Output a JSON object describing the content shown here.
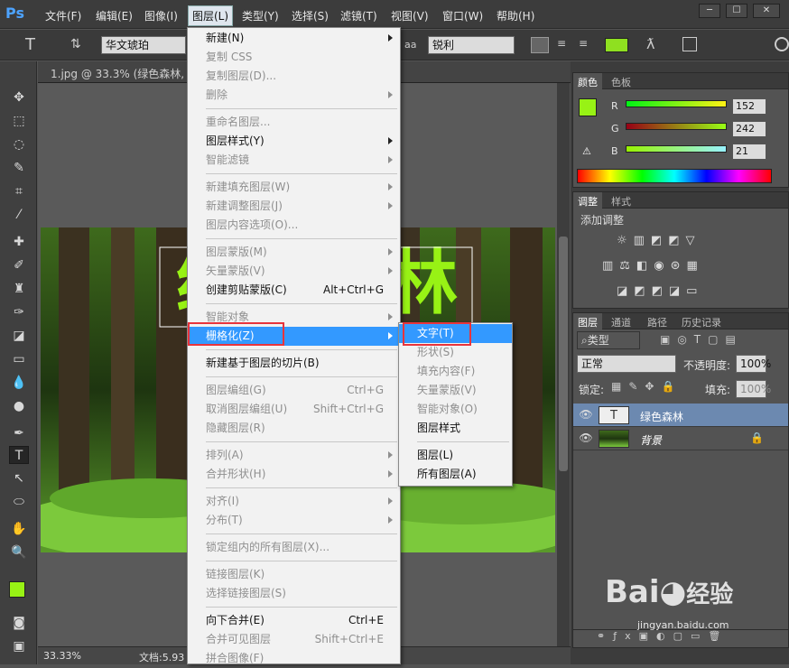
{
  "app": {
    "logo": "Ps"
  },
  "menubar": {
    "items": [
      "文件(F)",
      "编辑(E)",
      "图像(I)",
      "图层(L)",
      "类型(Y)",
      "选择(S)",
      "滤镜(T)",
      "视图(V)",
      "窗口(W)",
      "帮助(H)"
    ]
  },
  "window": {
    "min": "─",
    "max": "☐",
    "close": "✕"
  },
  "options": {
    "font_family": "华文琥珀",
    "aa_label": "aa",
    "aa_mode": "锐利",
    "text_color": "#8fe020"
  },
  "document": {
    "tab_title": "1.jpg @ 33.3% (绿色森林, R",
    "canvas_text": "绿色森林"
  },
  "status": {
    "zoom": "33.33%",
    "doc": "文档:5.93"
  },
  "color_panel": {
    "tabs": [
      "颜色",
      "色板"
    ],
    "r": "152",
    "g": "242",
    "b": "21",
    "r_label": "R",
    "g_label": "G",
    "b_label": "B",
    "fg": "#98f215"
  },
  "adjust_panel": {
    "tabs": [
      "调整",
      "样式"
    ],
    "title": "添加调整"
  },
  "layers_panel": {
    "tabs": [
      "图层",
      "通道",
      "路径",
      "历史记录"
    ],
    "filter": "类型",
    "blend": "正常",
    "opacity_label": "不透明度:",
    "opacity": "100%",
    "lock_label": "锁定:",
    "fill_label": "填充:",
    "fill": "100%",
    "layers": [
      {
        "name": "绿色森林",
        "type": "T"
      },
      {
        "name": "背景",
        "locked": true
      }
    ]
  },
  "layer_menu": {
    "items": [
      {
        "label": "新建(N)",
        "sub": true
      },
      {
        "label": "复制 CSS",
        "dis": true
      },
      {
        "label": "复制图层(D)...",
        "dis": true
      },
      {
        "label": "删除",
        "dis": true,
        "sub": true
      },
      {
        "sep": true
      },
      {
        "label": "重命名图层...",
        "dis": true
      },
      {
        "label": "图层样式(Y)",
        "sub": true
      },
      {
        "label": "智能滤镜",
        "dis": true,
        "sub": true
      },
      {
        "sep": true
      },
      {
        "label": "新建填充图层(W)",
        "dis": true,
        "sub": true
      },
      {
        "label": "新建调整图层(J)",
        "dis": true,
        "sub": true
      },
      {
        "label": "图层内容选项(O)...",
        "dis": true
      },
      {
        "sep": true
      },
      {
        "label": "图层蒙版(M)",
        "dis": true,
        "sub": true
      },
      {
        "label": "矢量蒙版(V)",
        "dis": true,
        "sub": true
      },
      {
        "label": "创建剪贴蒙版(C)",
        "shortcut": "Alt+Ctrl+G"
      },
      {
        "sep": true
      },
      {
        "label": "智能对象",
        "dis": true,
        "sub": true
      },
      {
        "label": "栅格化(Z)",
        "sub": true,
        "hl": true
      },
      {
        "sep": true
      },
      {
        "label": "新建基于图层的切片(B)"
      },
      {
        "sep": true
      },
      {
        "label": "图层编组(G)",
        "dis": true,
        "shortcut": "Ctrl+G"
      },
      {
        "label": "取消图层编组(U)",
        "dis": true,
        "shortcut": "Shift+Ctrl+G"
      },
      {
        "label": "隐藏图层(R)",
        "dis": true
      },
      {
        "sep": true
      },
      {
        "label": "排列(A)",
        "dis": true,
        "sub": true
      },
      {
        "label": "合并形状(H)",
        "dis": true,
        "sub": true
      },
      {
        "sep": true
      },
      {
        "label": "对齐(I)",
        "dis": true,
        "sub": true
      },
      {
        "label": "分布(T)",
        "dis": true,
        "sub": true
      },
      {
        "sep": true
      },
      {
        "label": "锁定组内的所有图层(X)...",
        "dis": true
      },
      {
        "sep": true
      },
      {
        "label": "链接图层(K)",
        "dis": true
      },
      {
        "label": "选择链接图层(S)",
        "dis": true
      },
      {
        "sep": true
      },
      {
        "label": "向下合并(E)",
        "shortcut": "Ctrl+E"
      },
      {
        "label": "合并可见图层",
        "dis": true,
        "shortcut": "Shift+Ctrl+E"
      },
      {
        "label": "拼合图像(F)",
        "dis": true
      }
    ]
  },
  "raster_menu": {
    "items": [
      {
        "label": "文字(T)",
        "hl": true
      },
      {
        "label": "形状(S)",
        "dis": true
      },
      {
        "label": "填充内容(F)",
        "dis": true
      },
      {
        "label": "矢量蒙版(V)",
        "dis": true
      },
      {
        "label": "智能对象(O)",
        "dis": true
      },
      {
        "label": "图层样式"
      },
      {
        "sep": true
      },
      {
        "label": "图层(L)"
      },
      {
        "label": "所有图层(A)"
      }
    ]
  },
  "watermark": {
    "text": "Bai",
    "text2": "经验",
    "url": "jingyan.baidu.com"
  }
}
